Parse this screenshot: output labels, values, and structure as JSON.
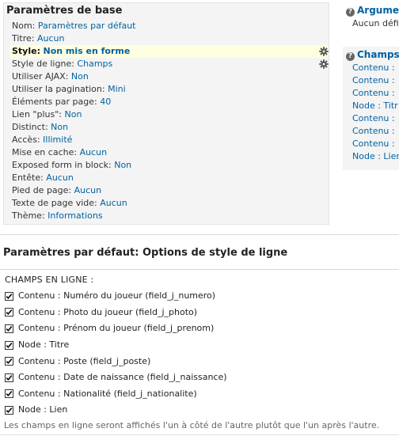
{
  "base": {
    "title": "Paramètres de base",
    "rows": [
      {
        "label": "Nom:",
        "value": "Paramètres par défaut",
        "highlight": false,
        "gear": false
      },
      {
        "label": "Titre:",
        "value": "Aucun",
        "highlight": false,
        "gear": false
      },
      {
        "label": "Style:",
        "value": "Non mis en forme",
        "highlight": true,
        "gear": true
      },
      {
        "label": "Style de ligne:",
        "value": "Champs",
        "highlight": false,
        "gear": true
      },
      {
        "label": "Utiliser AJAX:",
        "value": "Non",
        "highlight": false,
        "gear": false
      },
      {
        "label": "Utiliser la pagination:",
        "value": "Mini",
        "highlight": false,
        "gear": false
      },
      {
        "label": "Éléments par page:",
        "value": "40",
        "highlight": false,
        "gear": false
      },
      {
        "label": "Lien \"plus\":",
        "value": "Non",
        "highlight": false,
        "gear": false
      },
      {
        "label": "Distinct:",
        "value": "Non",
        "highlight": false,
        "gear": false
      },
      {
        "label": "Accès:",
        "value": "Illimité",
        "highlight": false,
        "gear": false
      },
      {
        "label": "Mise en cache:",
        "value": "Aucun",
        "highlight": false,
        "gear": false
      },
      {
        "label": "Exposed form in block:",
        "value": "Non",
        "highlight": false,
        "gear": false
      },
      {
        "label": "Entête:",
        "value": "Aucun",
        "highlight": false,
        "gear": false
      },
      {
        "label": "Pied de page:",
        "value": "Aucun",
        "highlight": false,
        "gear": false
      },
      {
        "label": "Texte de page vide:",
        "value": "Aucun",
        "highlight": false,
        "gear": false
      },
      {
        "label": "Thème:",
        "value": "Informations",
        "highlight": false,
        "gear": false
      }
    ]
  },
  "arguments": {
    "title": "Argume",
    "text": "Aucun défi"
  },
  "fields": {
    "title": "Champs",
    "items": [
      "Contenu :",
      "Contenu :",
      "Contenu :",
      "Node : Titr",
      "Contenu :",
      "Contenu :",
      "Contenu :",
      "Node : Lien"
    ]
  },
  "options": {
    "title": "Paramètres par défaut: Options de style de ligne",
    "heading": "CHAMPS EN LIGNE :",
    "items": [
      {
        "label": "Contenu : Numéro du joueur (field_j_numero)",
        "checked": true
      },
      {
        "label": "Contenu : Photo du joueur (field_j_photo)",
        "checked": true
      },
      {
        "label": "Contenu : Prénom du joueur (field_j_prenom)",
        "checked": true
      },
      {
        "label": "Node : Titre",
        "checked": true
      },
      {
        "label": "Contenu : Poste (field_j_poste)",
        "checked": true
      },
      {
        "label": "Contenu : Date de naissance (field_j_naissance)",
        "checked": true
      },
      {
        "label": "Contenu : Nationalité (field_j_nationalite)",
        "checked": true
      },
      {
        "label": "Node : Lien",
        "checked": true
      }
    ],
    "help": "Les champs en ligne seront affichés l'un à côté de l'autre plutôt que l'un après l'autre."
  },
  "icons": {
    "gear": "gear-icon",
    "help": "help-icon",
    "checkbox_check": "checkmark-icon"
  },
  "colors": {
    "link": "#0062a0",
    "panel_bg": "#f4f4f4",
    "highlight_bg": "#fffee0"
  }
}
